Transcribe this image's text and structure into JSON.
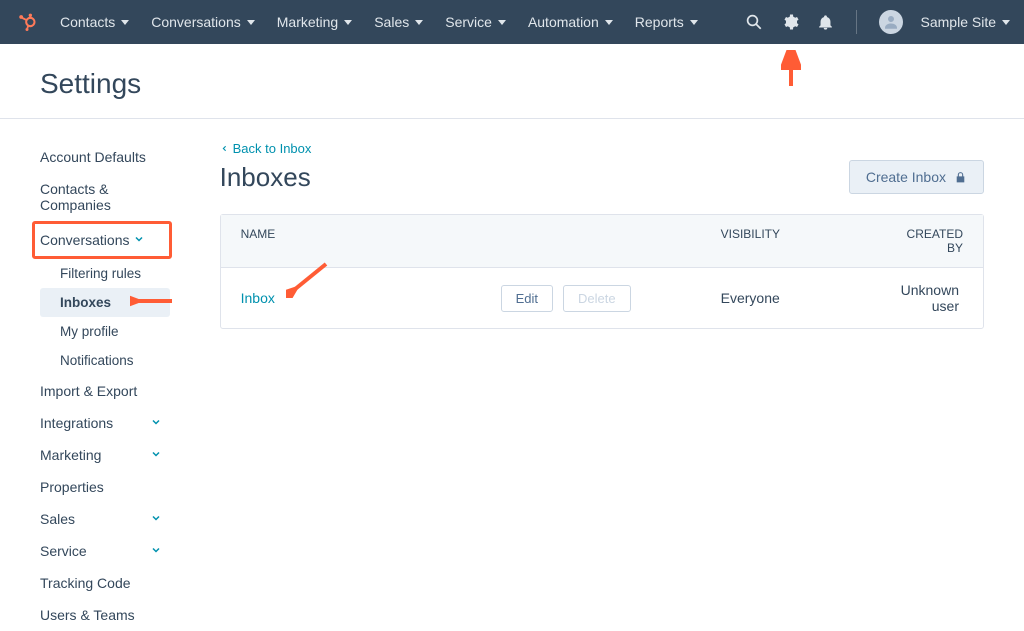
{
  "nav": {
    "items": [
      "Contacts",
      "Conversations",
      "Marketing",
      "Sales",
      "Service",
      "Automation",
      "Reports"
    ],
    "site_label": "Sample Site"
  },
  "page": {
    "title": "Settings"
  },
  "sidebar": {
    "items": [
      {
        "label": "Account Defaults"
      },
      {
        "label": "Contacts & Companies"
      },
      {
        "label": "Conversations",
        "expandable": true,
        "highlighted": true,
        "children": [
          {
            "label": "Filtering rules"
          },
          {
            "label": "Inboxes",
            "active": true
          },
          {
            "label": "My profile"
          },
          {
            "label": "Notifications"
          }
        ]
      },
      {
        "label": "Import & Export"
      },
      {
        "label": "Integrations",
        "expandable": true
      },
      {
        "label": "Marketing",
        "expandable": true
      },
      {
        "label": "Properties"
      },
      {
        "label": "Sales",
        "expandable": true
      },
      {
        "label": "Service",
        "expandable": true
      },
      {
        "label": "Tracking Code"
      },
      {
        "label": "Users & Teams"
      }
    ]
  },
  "main": {
    "back_label": "Back to Inbox",
    "title": "Inboxes",
    "create_btn": "Create Inbox",
    "columns": {
      "name": "NAME",
      "visibility": "VISIBILITY",
      "created_by": "CREATED BY"
    },
    "rows": [
      {
        "name": "Inbox",
        "edit": "Edit",
        "delete": "Delete",
        "visibility": "Everyone",
        "created_by": "Unknown user"
      }
    ]
  },
  "annotations": {
    "arrow_color": "#ff5c35"
  }
}
